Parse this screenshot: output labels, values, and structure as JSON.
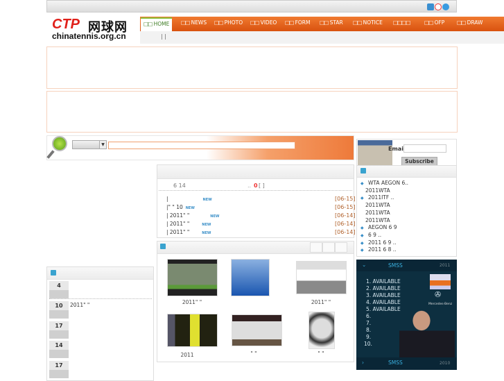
{
  "topbar": {
    "icons": [
      "qq-icon",
      "weibo-icon",
      "play-icon"
    ]
  },
  "logo": {
    "brand": "CTP",
    "name": "网球网",
    "domain": "chinatennis.org.cn"
  },
  "nav": {
    "items": [
      {
        "label": "HOME",
        "active": true
      },
      {
        "label": "NEWS"
      },
      {
        "label": "PHOTO"
      },
      {
        "label": "VIDEO"
      },
      {
        "label": "FORM"
      },
      {
        "label": "STAR"
      },
      {
        "label": "NOTICE"
      },
      {
        "label": "□□□□"
      },
      {
        "label": "OFP"
      },
      {
        "label": "DRAW"
      }
    ],
    "tofu": "□□",
    "sub": "|  |"
  },
  "search": {
    "select_value": "",
    "input_value": ""
  },
  "news": {
    "meta_left": "6 14",
    "meta_mid": "..",
    "meta_count": "0",
    "meta_bracket": "[ ]",
    "new_badge": "NEW",
    "rows": [
      {
        "text": "|",
        "date": "[06-15]"
      },
      {
        "text": "|\"  \"       10",
        "date": "[06-15]"
      },
      {
        "text": "| 2011\"     \"",
        "date": "[06-14]"
      },
      {
        "text": "| 2011\"     \"",
        "date": "[06-14]"
      },
      {
        "text": "| 2011\"     \"",
        "date": "[06-14]"
      }
    ]
  },
  "photos": {
    "captions": [
      "2011\"   \"",
      "",
      "2011\"   \"",
      "2011",
      "\"   \"",
      "\"  \""
    ]
  },
  "left_panel": {
    "items": [
      {
        "num": "4",
        "text": ""
      },
      {
        "num": "10",
        "text": "2011\"     \""
      },
      {
        "num": "17",
        "text": ""
      },
      {
        "num": "14",
        "text": ""
      },
      {
        "num": "17",
        "text": ""
      }
    ]
  },
  "subscribe": {
    "email_label": "Email",
    "email_value": "",
    "button": "Subscribe"
  },
  "right_list": {
    "items": [
      "  WTA AEGON      6..",
      "2011WTA",
      "   2011ITF       ..",
      "2011WTA",
      "2011WTA",
      "2011WTA",
      "   AEGON   6 9",
      "          6 9 ..",
      "   2011       6 9 ..",
      "   2011       6 8 .."
    ]
  },
  "smss": {
    "title": "SMSS",
    "year": "2011",
    "items": [
      "1.    AVAILABLE",
      "2.    AVAILABLE",
      "3.    AVAILABLE",
      "4.    AVAILABLE",
      "5.    AVAILABLE",
      "6.",
      "7.",
      "8.",
      "9.",
      "10."
    ],
    "sponsor": "Mercedes-Benz",
    "footer_title": "SMSS",
    "footer_year": "2010"
  },
  "colors": {
    "nav": "#e4621c",
    "smss_bg": "#0d2f40",
    "date": "#b0602a",
    "accent_blue": "#3aa3cf"
  }
}
